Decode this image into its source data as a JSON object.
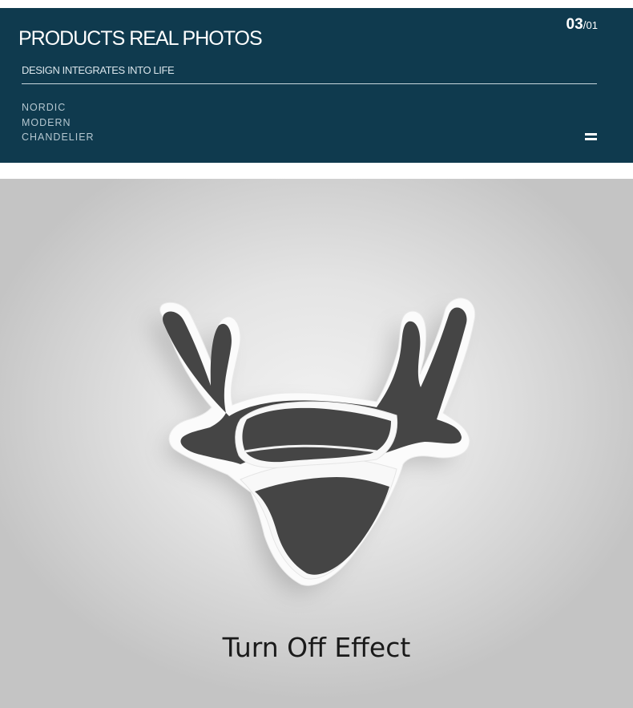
{
  "header": {
    "title": "PRODUCTS REAL PHOTOS",
    "page_current": "03",
    "page_separator": "/",
    "page_total": "01",
    "subtitle": "DESIGN INTEGRATES INTO LIFE",
    "taglines": [
      "NORDIC",
      "MODERN",
      "CHANDELIER"
    ],
    "menu_icon": "menu-icon"
  },
  "photo": {
    "caption": "Turn Off Effect",
    "subject": "deer-head-lamp"
  },
  "colors": {
    "banner": "#0f3a4e",
    "lamp_body": "#454545",
    "lamp_edge": "#fbfbfb"
  }
}
